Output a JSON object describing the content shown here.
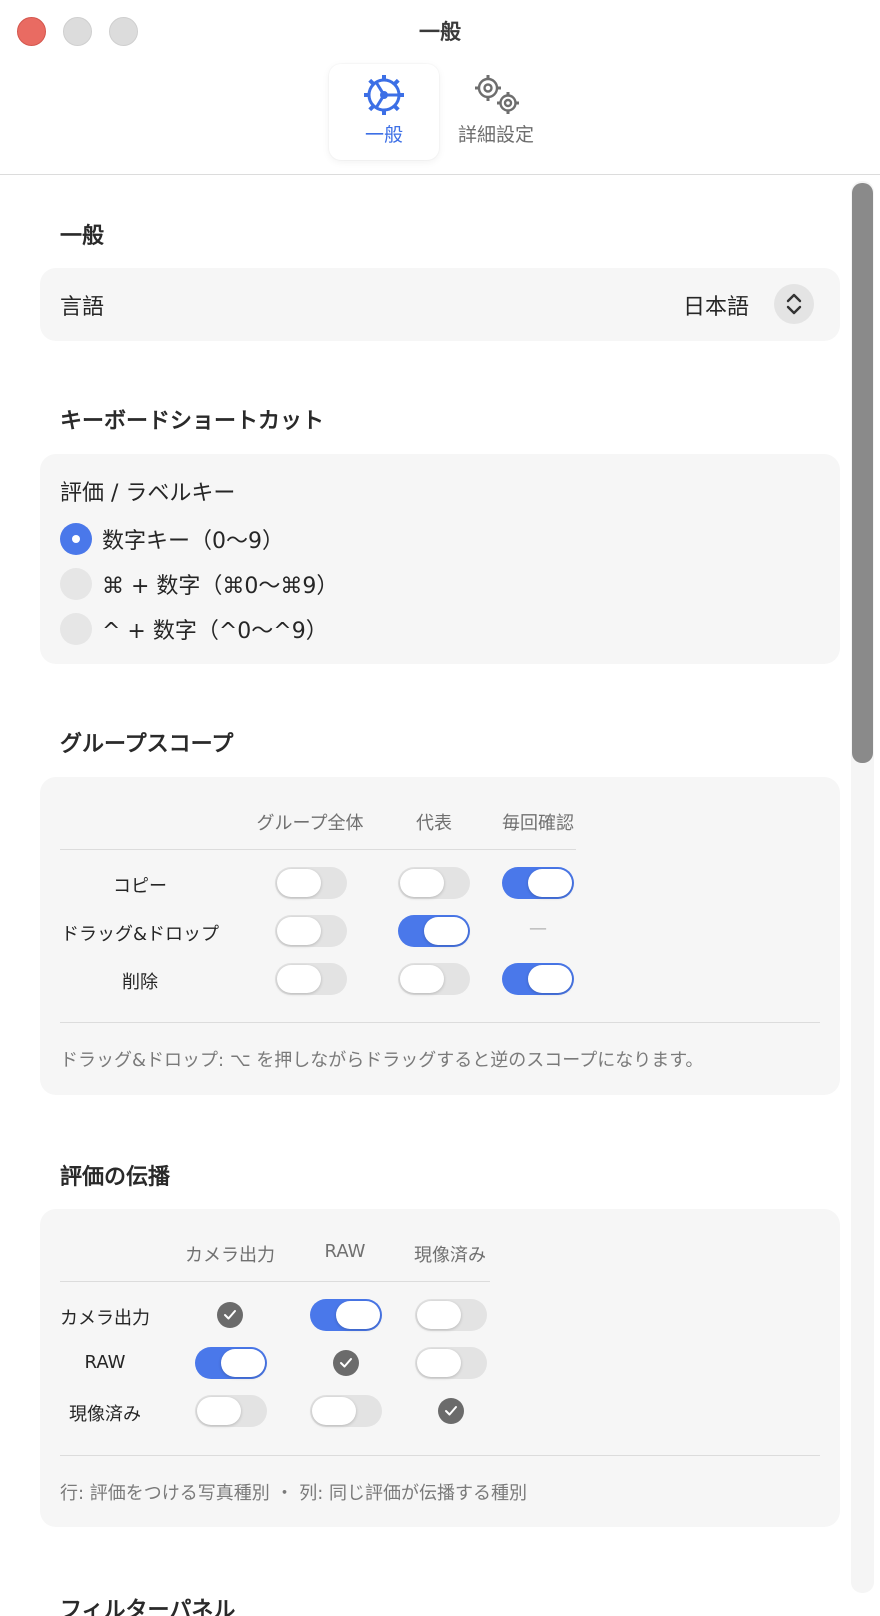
{
  "window": {
    "title": "一般"
  },
  "tabs": [
    {
      "label": "一般",
      "icon": "steering-gear-icon",
      "selected": true
    },
    {
      "label": "詳細設定",
      "icon": "gears-icon",
      "selected": false
    }
  ],
  "colors": {
    "accent": "#4a78ea",
    "card": "#f6f6f6",
    "close": "#e96b62"
  },
  "sections": {
    "general": {
      "title": "一般",
      "language": {
        "label": "言語",
        "value": "日本語"
      }
    },
    "shortcuts": {
      "title": "キーボードショートカット",
      "group_label": "評価 / ラベルキー",
      "options": [
        {
          "label": "数字キー（0〜9）",
          "selected": true
        },
        {
          "label": "⌘ + 数字（⌘0〜⌘9）",
          "selected": false
        },
        {
          "label": "^ + 数字（^0〜^9）",
          "selected": false
        }
      ]
    },
    "group_scope": {
      "title": "グループスコープ",
      "columns": [
        "グループ全体",
        "代表",
        "毎回確認"
      ],
      "rows": [
        {
          "label": "コピー",
          "values": [
            false,
            false,
            true
          ]
        },
        {
          "label": "ドラッグ&ドロップ",
          "values": [
            false,
            true,
            null
          ]
        },
        {
          "label": "削除",
          "values": [
            false,
            false,
            true
          ]
        }
      ],
      "dash": "—",
      "note": "ドラッグ&ドロップ: ⌥ を押しながらドラッグすると逆のスコープになります。"
    },
    "propagation": {
      "title": "評価の伝播",
      "columns": [
        "カメラ出力",
        "RAW",
        "現像済み"
      ],
      "rows": [
        {
          "label": "カメラ出力",
          "values": [
            "self",
            true,
            false
          ]
        },
        {
          "label": "RAW",
          "values": [
            true,
            "self",
            false
          ]
        },
        {
          "label": "現像済み",
          "values": [
            false,
            false,
            "self"
          ]
        }
      ],
      "note": "行: 評価をつける写真種別 ・ 列: 同じ評価が伝播する種別"
    },
    "filter": {
      "title": "フィルターパネル"
    }
  }
}
